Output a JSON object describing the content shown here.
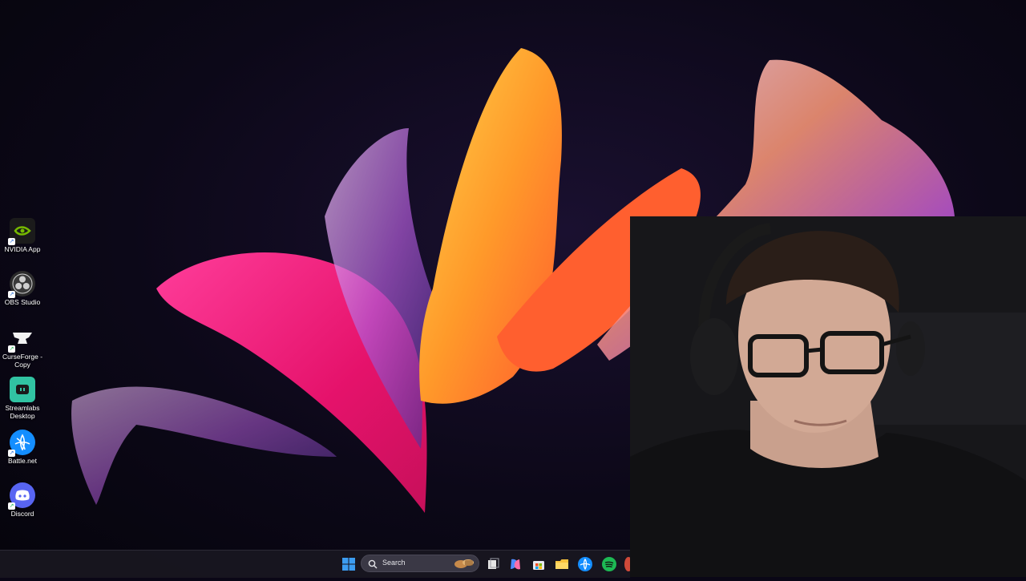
{
  "desktop": {
    "icons": [
      {
        "label": "NVIDIA App",
        "icon": "nvidia-icon"
      },
      {
        "label": "OBS Studio",
        "icon": "obs-icon"
      },
      {
        "label": "CurseForge - Copy",
        "icon": "curseforge-icon"
      },
      {
        "label": "Streamlabs Desktop",
        "icon": "streamlabs-icon"
      },
      {
        "label": "Battle.net",
        "icon": "battlenet-icon"
      },
      {
        "label": "Discord",
        "icon": "discord-icon"
      }
    ]
  },
  "taskbar": {
    "search_placeholder": "Search",
    "pinned": [
      "start-icon",
      "task-view-icon",
      "copilot-icon",
      "store-icon",
      "file-explorer-icon",
      "battlenet-icon",
      "spotify-icon"
    ]
  },
  "colors": {
    "nvidia": "#76b900",
    "obs": "#2b2b2b",
    "streamlabs": "#31c3a2",
    "battlenet": "#148eff",
    "discord": "#5865f2",
    "spotify": "#1db954",
    "start": "#3c9cf0"
  }
}
